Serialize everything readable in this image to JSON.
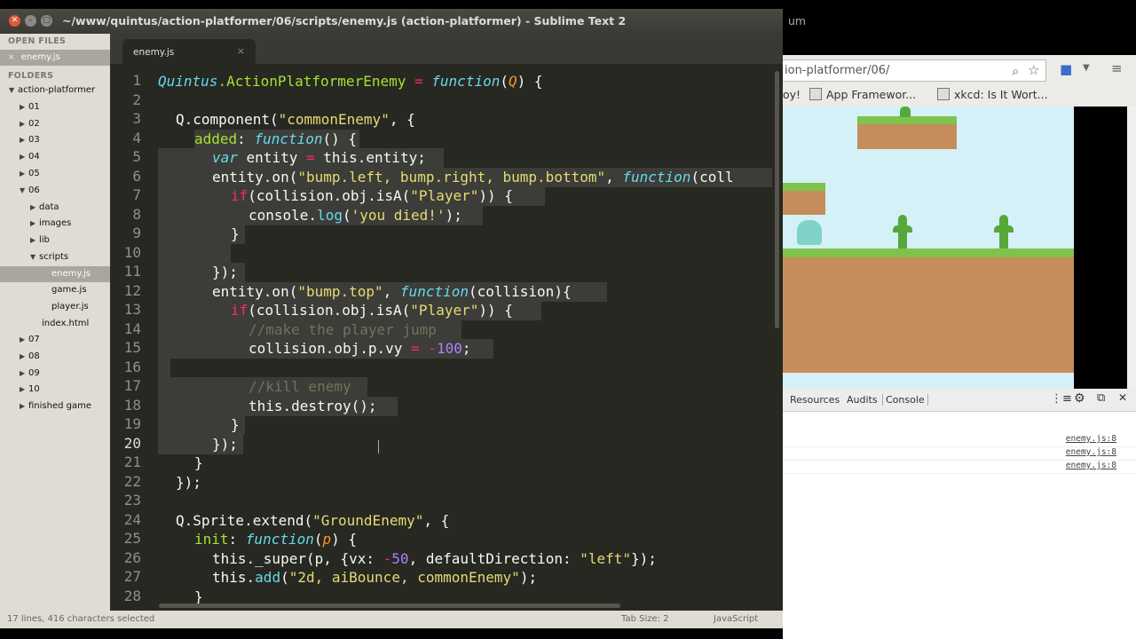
{
  "window_title": "~/www/quintus/action-platformer/06/scripts/enemy.js (action-platformer) - Sublime Text 2",
  "sidebar": {
    "open_files_header": "OPEN FILES",
    "open_file": "enemy.js",
    "folders_header": "FOLDERS",
    "items": [
      {
        "label": "action-platformer",
        "arrow": "▼"
      },
      {
        "label": "01",
        "arrow": "▶"
      },
      {
        "label": "02",
        "arrow": "▶"
      },
      {
        "label": "03",
        "arrow": "▶"
      },
      {
        "label": "04",
        "arrow": "▶"
      },
      {
        "label": "05",
        "arrow": "▶"
      },
      {
        "label": "06",
        "arrow": "▼"
      },
      {
        "label": "data",
        "arrow": "▶"
      },
      {
        "label": "images",
        "arrow": "▶"
      },
      {
        "label": "lib",
        "arrow": "▶"
      },
      {
        "label": "scripts",
        "arrow": "▼"
      },
      {
        "label": "enemy.js",
        "arrow": ""
      },
      {
        "label": "game.js",
        "arrow": ""
      },
      {
        "label": "player.js",
        "arrow": ""
      },
      {
        "label": "index.html",
        "arrow": ""
      },
      {
        "label": "07",
        "arrow": "▶"
      },
      {
        "label": "08",
        "arrow": "▶"
      },
      {
        "label": "09",
        "arrow": "▶"
      },
      {
        "label": "10",
        "arrow": "▶"
      },
      {
        "label": "finished game",
        "arrow": "▶"
      }
    ]
  },
  "tab": {
    "label": "enemy.js",
    "close": "×"
  },
  "line_numbers": [
    "1",
    "2",
    "3",
    "4",
    "5",
    "6",
    "7",
    "8",
    "9",
    "10",
    "11",
    "12",
    "13",
    "14",
    "15",
    "16",
    "17",
    "18",
    "19",
    "20",
    "21",
    "22",
    "23",
    "24",
    "25",
    "26",
    "27",
    "28"
  ],
  "code": {
    "l1_obj": "Quintus",
    "l1_prop": ".ActionPlatformerEnemy ",
    "l1_eq": "=",
    "l1_fn": "function",
    "l1_p1": "(",
    "l1_arg": "Q",
    "l1_p2": ") {",
    "l3_a": "Q.component(",
    "l3_s": "\"commonEnemy\"",
    "l3_b": ", {",
    "l4_key": "added",
    "l4_colon": ": ",
    "l4_fn": "function",
    "l4_rest": "() {",
    "l5_var": "var",
    "l5_a": " entity ",
    "l5_eq": "=",
    "l5_b": " this.entity;",
    "l6_a": "entity.on(",
    "l6_s": "\"bump.left, bump.right, bump.bottom\"",
    "l6_b": ", ",
    "l6_fn": "function",
    "l6_c": "(coll",
    "l7_if": "if",
    "l7_a": "(collision.obj.isA(",
    "l7_s": "\"Player\"",
    "l7_b": ")) {",
    "l8_a": "console.",
    "l8_m": "log",
    "l8_b": "(",
    "l8_s": "'you died!'",
    "l8_c": ");",
    "l9": "}",
    "l11": "});",
    "l12_a": "entity.on(",
    "l12_s": "\"bump.top\"",
    "l12_b": ", ",
    "l12_fn": "function",
    "l12_c": "(collision){",
    "l13_if": "if",
    "l13_a": "(collision.obj.isA(",
    "l13_s": "\"Player\"",
    "l13_b": ")) {",
    "l14": "//make the player jump",
    "l15_a": "collision.obj.p.vy ",
    "l15_eq": "=",
    "l15_sp": " ",
    "l15_minus": "-",
    "l15_n": "100",
    "l15_b": ";",
    "l17": "//kill enemy",
    "l18": "this.destroy();",
    "l19": "}",
    "l20": "});",
    "l21": "}",
    "l22": "});",
    "l24_a": "Q.Sprite.extend(",
    "l24_s": "\"GroundEnemy\"",
    "l24_b": ", {",
    "l25_key": "init",
    "l25_colon": ": ",
    "l25_fn": "function",
    "l25_p1": "(",
    "l25_arg": "p",
    "l25_p2": ") {",
    "l26_a": "this._super(p, {vx: ",
    "l26_minus": "-",
    "l26_n": "50",
    "l26_b": ", defaultDirection: ",
    "l26_s": "\"left\"",
    "l26_c": "});",
    "l27_a": "this.",
    "l27_m": "add",
    "l27_b": "(",
    "l27_s": "\"2d, aiBounce, commonEnemy\"",
    "l27_c": ");",
    "l28": "}"
  },
  "status": {
    "left": "17 lines, 416 characters selected",
    "tab_size": "Tab Size: 2",
    "syntax": "JavaScript"
  },
  "browser": {
    "title_fragment": "um",
    "url": "ion-platformer/06/",
    "bookmarks": [
      "oy!",
      "App Framewor...",
      "xkcd: Is It Wort..."
    ],
    "devtools_tabs": [
      "Resources",
      "Audits",
      "Console"
    ],
    "console_links": [
      "enemy.js:8",
      "enemy.js:8",
      "enemy.js:8"
    ]
  },
  "colors": {
    "editor_bg": "#272822",
    "keyword": "#f92672",
    "function_kw": "#66d9ef",
    "string": "#e6db74",
    "number": "#ae81ff",
    "comment": "#75715e"
  }
}
